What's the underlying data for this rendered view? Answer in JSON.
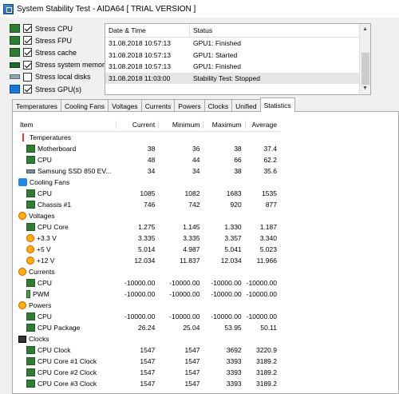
{
  "window": {
    "title": "System Stability Test - AIDA64  [ TRIAL VERSION ]"
  },
  "stress_options": [
    {
      "label": "Stress CPU",
      "checked": true,
      "icon": "cpu-icon"
    },
    {
      "label": "Stress FPU",
      "checked": true,
      "icon": "fpu-icon"
    },
    {
      "label": "Stress cache",
      "checked": true,
      "icon": "cache-icon"
    },
    {
      "label": "Stress system memory",
      "checked": true,
      "icon": "memory-icon"
    },
    {
      "label": "Stress local disks",
      "checked": false,
      "icon": "disk-icon"
    },
    {
      "label": "Stress GPU(s)",
      "checked": true,
      "icon": "gpu-icon"
    }
  ],
  "log": {
    "headers": {
      "datetime": "Date & Time",
      "status": "Status"
    },
    "rows": [
      {
        "datetime": "31.08.2018 10:57:13",
        "status": "GPU1: Finished"
      },
      {
        "datetime": "31.08.2018 10:57:13",
        "status": "GPU1: Started"
      },
      {
        "datetime": "31.08.2018 10:57:13",
        "status": "GPU1: Finished"
      },
      {
        "datetime": "31.08.2018 11:03:00",
        "status": "Stability Test: Stopped"
      }
    ]
  },
  "tabs": [
    "Temperatures",
    "Cooling Fans",
    "Voltages",
    "Currents",
    "Powers",
    "Clocks",
    "Unified",
    "Statistics"
  ],
  "active_tab": "Statistics",
  "stats": {
    "headers": {
      "item": "Item",
      "current": "Current",
      "minimum": "Minimum",
      "maximum": "Maximum",
      "average": "Average"
    },
    "rows": [
      {
        "type": "group",
        "name": "Temperatures",
        "icon": "thermometer-icon"
      },
      {
        "type": "row",
        "name": "Motherboard",
        "icon": "motherboard-icon",
        "current": "38",
        "minimum": "36",
        "maximum": "38",
        "average": "37.4"
      },
      {
        "type": "row",
        "name": "CPU",
        "icon": "cpu-chip-icon",
        "current": "48",
        "minimum": "44",
        "maximum": "66",
        "average": "62.2"
      },
      {
        "type": "row",
        "name": "Samsung SSD 850 EV...",
        "icon": "ssd-icon",
        "current": "34",
        "minimum": "34",
        "maximum": "38",
        "average": "35.6"
      },
      {
        "type": "group",
        "name": "Cooling Fans",
        "icon": "fan-icon"
      },
      {
        "type": "row",
        "name": "CPU",
        "icon": "cpu-chip-icon",
        "current": "1085",
        "minimum": "1082",
        "maximum": "1683",
        "average": "1535"
      },
      {
        "type": "row",
        "name": "Chassis #1",
        "icon": "chassis-icon",
        "current": "746",
        "minimum": "742",
        "maximum": "920",
        "average": "877"
      },
      {
        "type": "group",
        "name": "Voltages",
        "icon": "voltage-icon"
      },
      {
        "type": "row",
        "name": "CPU Core",
        "icon": "cpu-chip-icon",
        "current": "1.275",
        "minimum": "1.145",
        "maximum": "1.330",
        "average": "1.187"
      },
      {
        "type": "row",
        "name": "+3.3 V",
        "icon": "voltage-icon",
        "current": "3.335",
        "minimum": "3.335",
        "maximum": "3.357",
        "average": "3.340"
      },
      {
        "type": "row",
        "name": "+5 V",
        "icon": "voltage-icon",
        "current": "5.014",
        "minimum": "4.987",
        "maximum": "5.041",
        "average": "5.023"
      },
      {
        "type": "row",
        "name": "+12 V",
        "icon": "voltage-icon",
        "current": "12.034",
        "minimum": "11.837",
        "maximum": "12.034",
        "average": "11.966"
      },
      {
        "type": "group",
        "name": "Currents",
        "icon": "current-icon"
      },
      {
        "type": "row",
        "name": "CPU",
        "icon": "cpu-chip-icon",
        "current": "-10000.00",
        "minimum": "-10000.00",
        "maximum": "-10000.00",
        "average": "-10000.00"
      },
      {
        "type": "row",
        "name": "PWM",
        "icon": "battery-icon",
        "current": "-10000.00",
        "minimum": "-10000.00",
        "maximum": "-10000.00",
        "average": "-10000.00"
      },
      {
        "type": "group",
        "name": "Powers",
        "icon": "power-icon"
      },
      {
        "type": "row",
        "name": "CPU",
        "icon": "cpu-chip-icon",
        "current": "-10000.00",
        "minimum": "-10000.00",
        "maximum": "-10000.00",
        "average": "-10000.00"
      },
      {
        "type": "row",
        "name": "CPU Package",
        "icon": "cpu-chip-icon",
        "current": "26.24",
        "minimum": "25.04",
        "maximum": "53.95",
        "average": "50.11"
      },
      {
        "type": "group",
        "name": "Clocks",
        "icon": "clock-icon"
      },
      {
        "type": "row",
        "name": "CPU Clock",
        "icon": "cpu-chip-icon",
        "current": "1547",
        "minimum": "1547",
        "maximum": "3692",
        "average": "3220.9"
      },
      {
        "type": "row",
        "name": "CPU Core #1 Clock",
        "icon": "cpu-chip-icon",
        "current": "1547",
        "minimum": "1547",
        "maximum": "3393",
        "average": "3189.2"
      },
      {
        "type": "row",
        "name": "CPU Core #2 Clock",
        "icon": "cpu-chip-icon",
        "current": "1547",
        "minimum": "1547",
        "maximum": "3393",
        "average": "3189.2"
      },
      {
        "type": "row",
        "name": "CPU Core #3 Clock",
        "icon": "cpu-chip-icon",
        "current": "1547",
        "minimum": "1547",
        "maximum": "3393",
        "average": "3189.2"
      }
    ]
  }
}
